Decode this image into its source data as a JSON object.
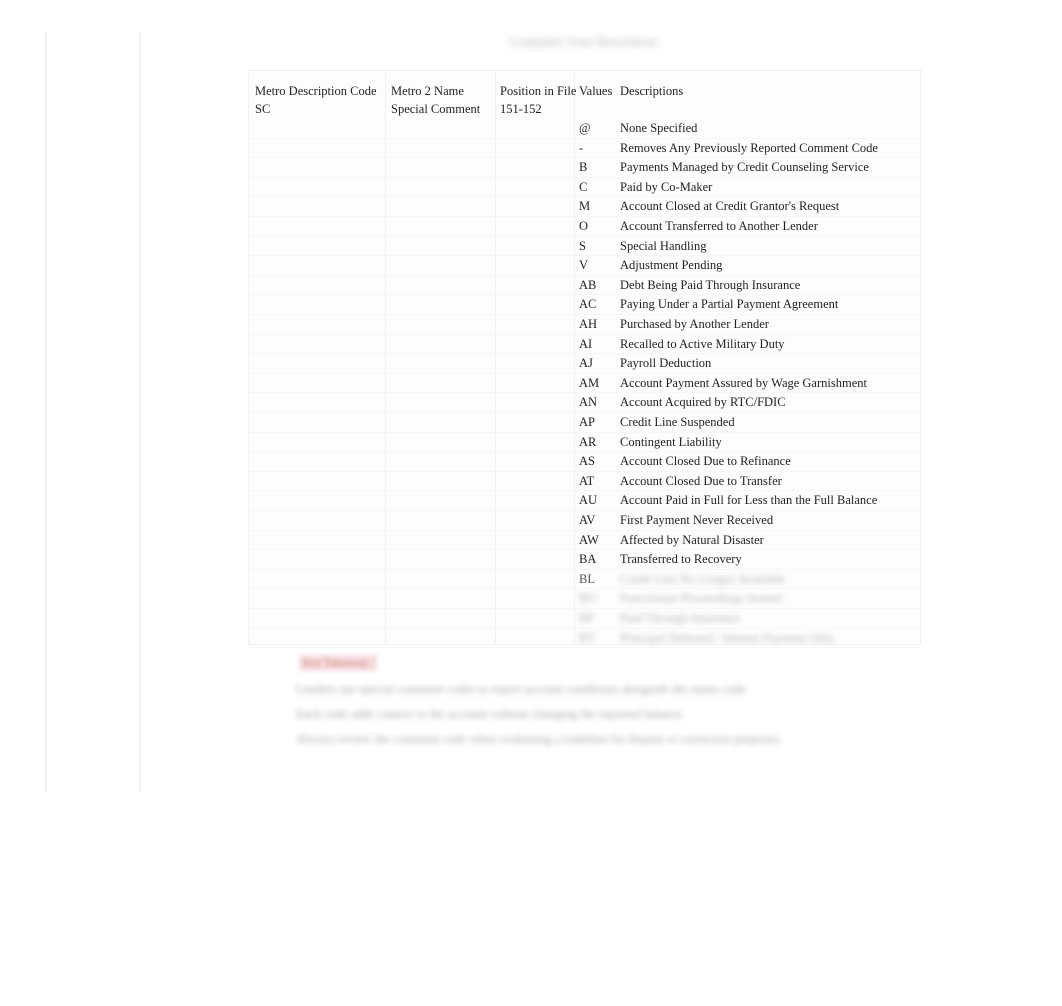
{
  "document": {
    "title_redacted": "Complete Your Resolution",
    "background_color": "#ffffff"
  },
  "table": {
    "headers": {
      "metro_description_code": "Metro Description Code\nSC",
      "metro_2_name": "Metro 2 Name\nSpecial Comment",
      "position_in_file": "Position in File\n151-152",
      "values": "Values",
      "descriptions": "Descriptions"
    },
    "rows": [
      {
        "code": "@",
        "description": "None Specified",
        "faded": false
      },
      {
        "code": "-",
        "description": "Removes Any Previously Reported Comment Code",
        "faded": false
      },
      {
        "code": "B",
        "description": "Payments Managed by Credit Counseling Service",
        "faded": false
      },
      {
        "code": "C",
        "description": "Paid by Co-Maker",
        "faded": false
      },
      {
        "code": "M",
        "description": "Account Closed at Credit Grantor's Request",
        "faded": false
      },
      {
        "code": "O",
        "description": "Account Transferred to Another Lender",
        "faded": false
      },
      {
        "code": "S",
        "description": "Special Handling",
        "faded": false
      },
      {
        "code": "V",
        "description": "Adjustment Pending",
        "faded": false
      },
      {
        "code": "AB",
        "description": "Debt Being Paid Through Insurance",
        "faded": false
      },
      {
        "code": "AC",
        "description": "Paying Under a Partial Payment Agreement",
        "faded": false
      },
      {
        "code": "AH",
        "description": "Purchased by Another Lender",
        "faded": false
      },
      {
        "code": "AI",
        "description": "Recalled to Active Military Duty",
        "faded": false
      },
      {
        "code": "AJ",
        "description": "Payroll Deduction",
        "faded": false
      },
      {
        "code": "AM",
        "description": "Account Payment Assured by Wage Garnishment",
        "faded": false
      },
      {
        "code": "AN",
        "description": "Account Acquired by RTC/FDIC",
        "faded": false
      },
      {
        "code": "AP",
        "description": "Credit Line Suspended",
        "faded": false
      },
      {
        "code": "AR",
        "description": "Contingent Liability",
        "faded": false
      },
      {
        "code": "AS",
        "description": "Account Closed Due to Refinance",
        "faded": false
      },
      {
        "code": "AT",
        "description": "Account Closed Due to Transfer",
        "faded": false
      },
      {
        "code": "AU",
        "description": "Account Paid in Full for Less than the Full Balance",
        "faded": false
      },
      {
        "code": "AV",
        "description": "First Payment Never Received",
        "faded": false
      },
      {
        "code": "AW",
        "description": "Affected by Natural Disaster",
        "faded": false
      },
      {
        "code": "BA",
        "description": "Transferred to Recovery",
        "faded": false
      },
      {
        "code": "BL",
        "description": "Credit Line No Longer Available",
        "faded": true
      },
      {
        "code": "BO",
        "description": "Foreclosure Proceedings Started",
        "faded": true
      },
      {
        "code": "BP",
        "description": "Paid Through Insurance",
        "faded": true
      },
      {
        "code": "BT",
        "description": "Principal Deferred / Interest Payment Only",
        "faded": true
      }
    ]
  },
  "footer": {
    "redacted_label": "Key Takeaway",
    "paragraphs": [
      "Lenders use special comment codes to report account conditions alongside the status code.",
      "Each code adds context to the account without changing the reported balance.",
      "Always review the comment code when evaluating a tradeline for dispute or correction purposes."
    ]
  }
}
